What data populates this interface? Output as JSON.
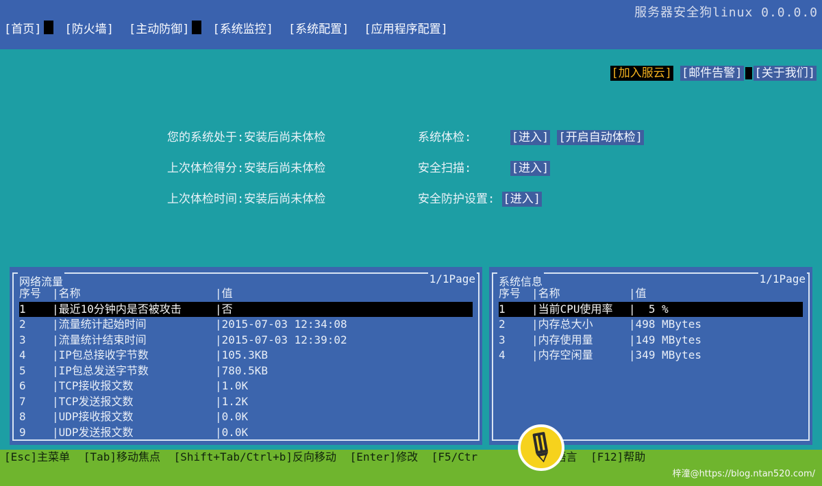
{
  "app": {
    "title": "服务器安全狗linux 0.0.0.0"
  },
  "nav": {
    "items": [
      {
        "label": "[首页]"
      },
      {
        "label": "[防火墙]"
      },
      {
        "label": "[主动防御]"
      },
      {
        "label": "[系统监控]"
      },
      {
        "label": "[系统配置]"
      },
      {
        "label": "[应用程序配置]"
      }
    ]
  },
  "toplinks": {
    "join_cloud": "[加入服云]",
    "mail_alert": "[邮件告警]",
    "about_us": "[关于我们]"
  },
  "status": {
    "system_state_label": "您的系统处于:安装后尚未体检",
    "last_score_label": "上次体检得分:安装后尚未体检",
    "last_time_label": "上次体检时间:安装后尚未体检",
    "checkup_label": "系统体检:",
    "scan_label": "安全扫描:",
    "protect_label": "安全防护设置:",
    "enter_label": "[进入]",
    "auto_checkup_label": "[开启自动体检]"
  },
  "network_panel": {
    "title": "网络流量",
    "page": "1/1Page",
    "columns": [
      "序号",
      "|名称",
      "|值"
    ],
    "rows": [
      {
        "idx": "1",
        "name": "|最近10分钟内是否被攻击",
        "value": "|否"
      },
      {
        "idx": "2",
        "name": "|流量统计起始时间",
        "value": "|2015-07-03 12:34:08"
      },
      {
        "idx": "3",
        "name": "|流量统计结束时间",
        "value": "|2015-07-03 12:39:02"
      },
      {
        "idx": "4",
        "name": "|IP包总接收字节数",
        "value": "|105.3KB"
      },
      {
        "idx": "5",
        "name": "|IP包总发送字节数",
        "value": "|780.5KB"
      },
      {
        "idx": "6",
        "name": "|TCP接收报文数",
        "value": "|1.0K"
      },
      {
        "idx": "7",
        "name": "|TCP发送报文数",
        "value": "|1.2K"
      },
      {
        "idx": "8",
        "name": "|UDP接收报文数",
        "value": "|0.0K"
      },
      {
        "idx": "9",
        "name": "|UDP发送报文数",
        "value": "|0.0K"
      }
    ]
  },
  "system_panel": {
    "title": "系统信息",
    "page": "1/1Page",
    "columns": [
      "序号",
      "|名称",
      "|值"
    ],
    "rows": [
      {
        "idx": "1",
        "name": "|当前CPU使用率",
        "value": "|  5 %"
      },
      {
        "idx": "2",
        "name": "|内存总大小",
        "value": "|498 MBytes"
      },
      {
        "idx": "3",
        "name": "|内存使用量",
        "value": "|149 MBytes"
      },
      {
        "idx": "4",
        "name": "|内存空闲量",
        "value": "|349 MBytes"
      }
    ]
  },
  "footer": {
    "hints": [
      "[Esc]主菜单",
      "[Tab]移动焦点",
      "[Shift+Tab/Ctrl+b]反向移动",
      "[Enter]修改",
      "[F5/Ctr",
      "换语言",
      "[F12]帮助"
    ],
    "watermark": "梓潼@https://blog.ntan520.com/"
  },
  "colors": {
    "top_bar": "#3a62ae",
    "background": "#1d9ea4",
    "panel": "#3c65ad",
    "footer": "#6fb52e",
    "highlight_text": "#f2b01e"
  }
}
